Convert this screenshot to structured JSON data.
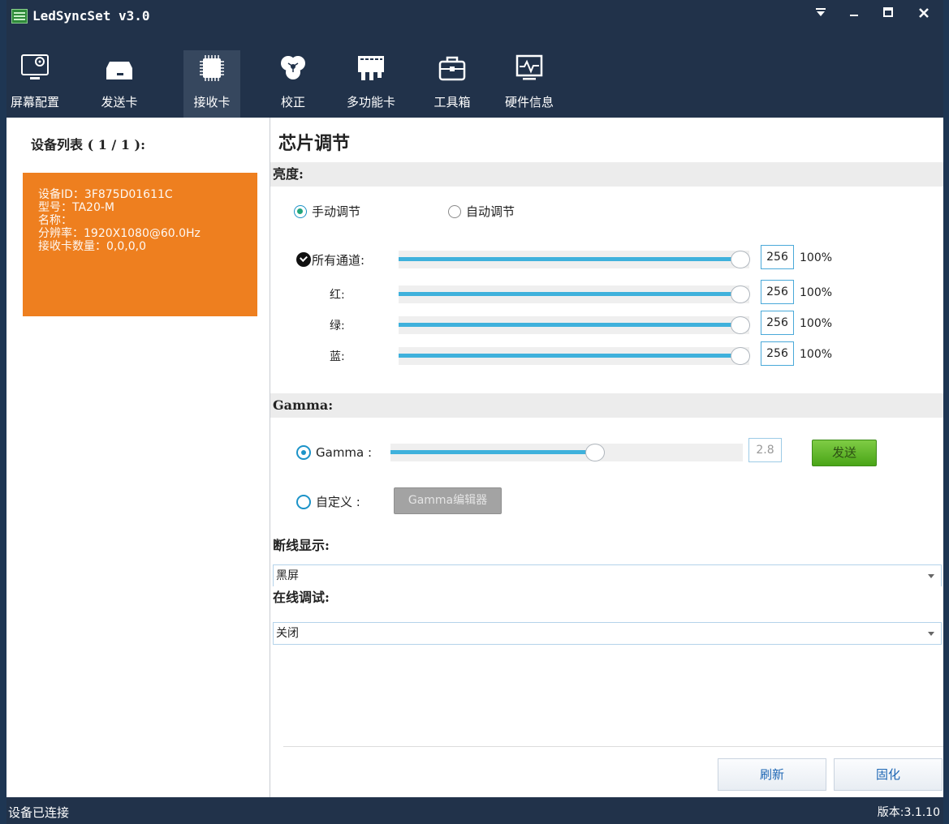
{
  "window": {
    "title": "LedSyncSet v3.0"
  },
  "toolbar": {
    "items": [
      {
        "label": "屏幕配置",
        "icon": "monitor-gear-icon",
        "active": false
      },
      {
        "label": "发送卡",
        "icon": "sender-card-icon",
        "active": false
      },
      {
        "label": "接收卡",
        "icon": "chip-icon",
        "active": true
      },
      {
        "label": "校正",
        "icon": "color-wheel-icon",
        "active": false
      },
      {
        "label": "多功能卡",
        "icon": "multifunction-card-icon",
        "active": false
      },
      {
        "label": "工具箱",
        "icon": "toolbox-icon",
        "active": false
      },
      {
        "label": "硬件信息",
        "icon": "hardware-monitor-icon",
        "active": false
      }
    ]
  },
  "device_list": {
    "title": "设备列表 ( 1 / 1 ):",
    "device": {
      "id_line": "设备ID：3F875D01611C",
      "model_line": "型号：TA20-M",
      "name_line": "名称：",
      "resolution_line": "分辨率：1920X1080@60.0Hz",
      "cards_line": "接收卡数量：0,0,0,0",
      "color": "#ee7f1f"
    }
  },
  "panel": {
    "title": "芯片调节",
    "brightness": {
      "heading": "亮度:",
      "mode_manual": "手动调节",
      "mode_auto": "自动调节",
      "selected_mode": "manual",
      "channels": [
        {
          "label": "所有通道:",
          "value": "256",
          "percent": "100%"
        },
        {
          "label": "红:",
          "value": "256",
          "percent": "100%"
        },
        {
          "label": "绿:",
          "value": "256",
          "percent": "100%"
        },
        {
          "label": "蓝:",
          "value": "256",
          "percent": "100%"
        }
      ]
    },
    "gamma": {
      "heading": "Gamma:",
      "gamma_option": "Gamma :",
      "gamma_value": "2.8",
      "gamma_level_fraction": 0.58,
      "send_label": "发送",
      "custom_option": "自定义 :",
      "editor_label": "Gamma编辑器"
    },
    "disconnect_display": {
      "heading": "断线显示:",
      "value": "黑屏"
    },
    "online_debug": {
      "heading": "在线调试:",
      "value": "关闭"
    },
    "refresh_label": "刷新",
    "solidify_label": "固化"
  },
  "status": {
    "text": "设备已连接",
    "version": "版本:3.1.10"
  },
  "colors": {
    "accent": "#3fb1dc",
    "send_green": "#5ab52a",
    "titlebar": "#21324a"
  }
}
